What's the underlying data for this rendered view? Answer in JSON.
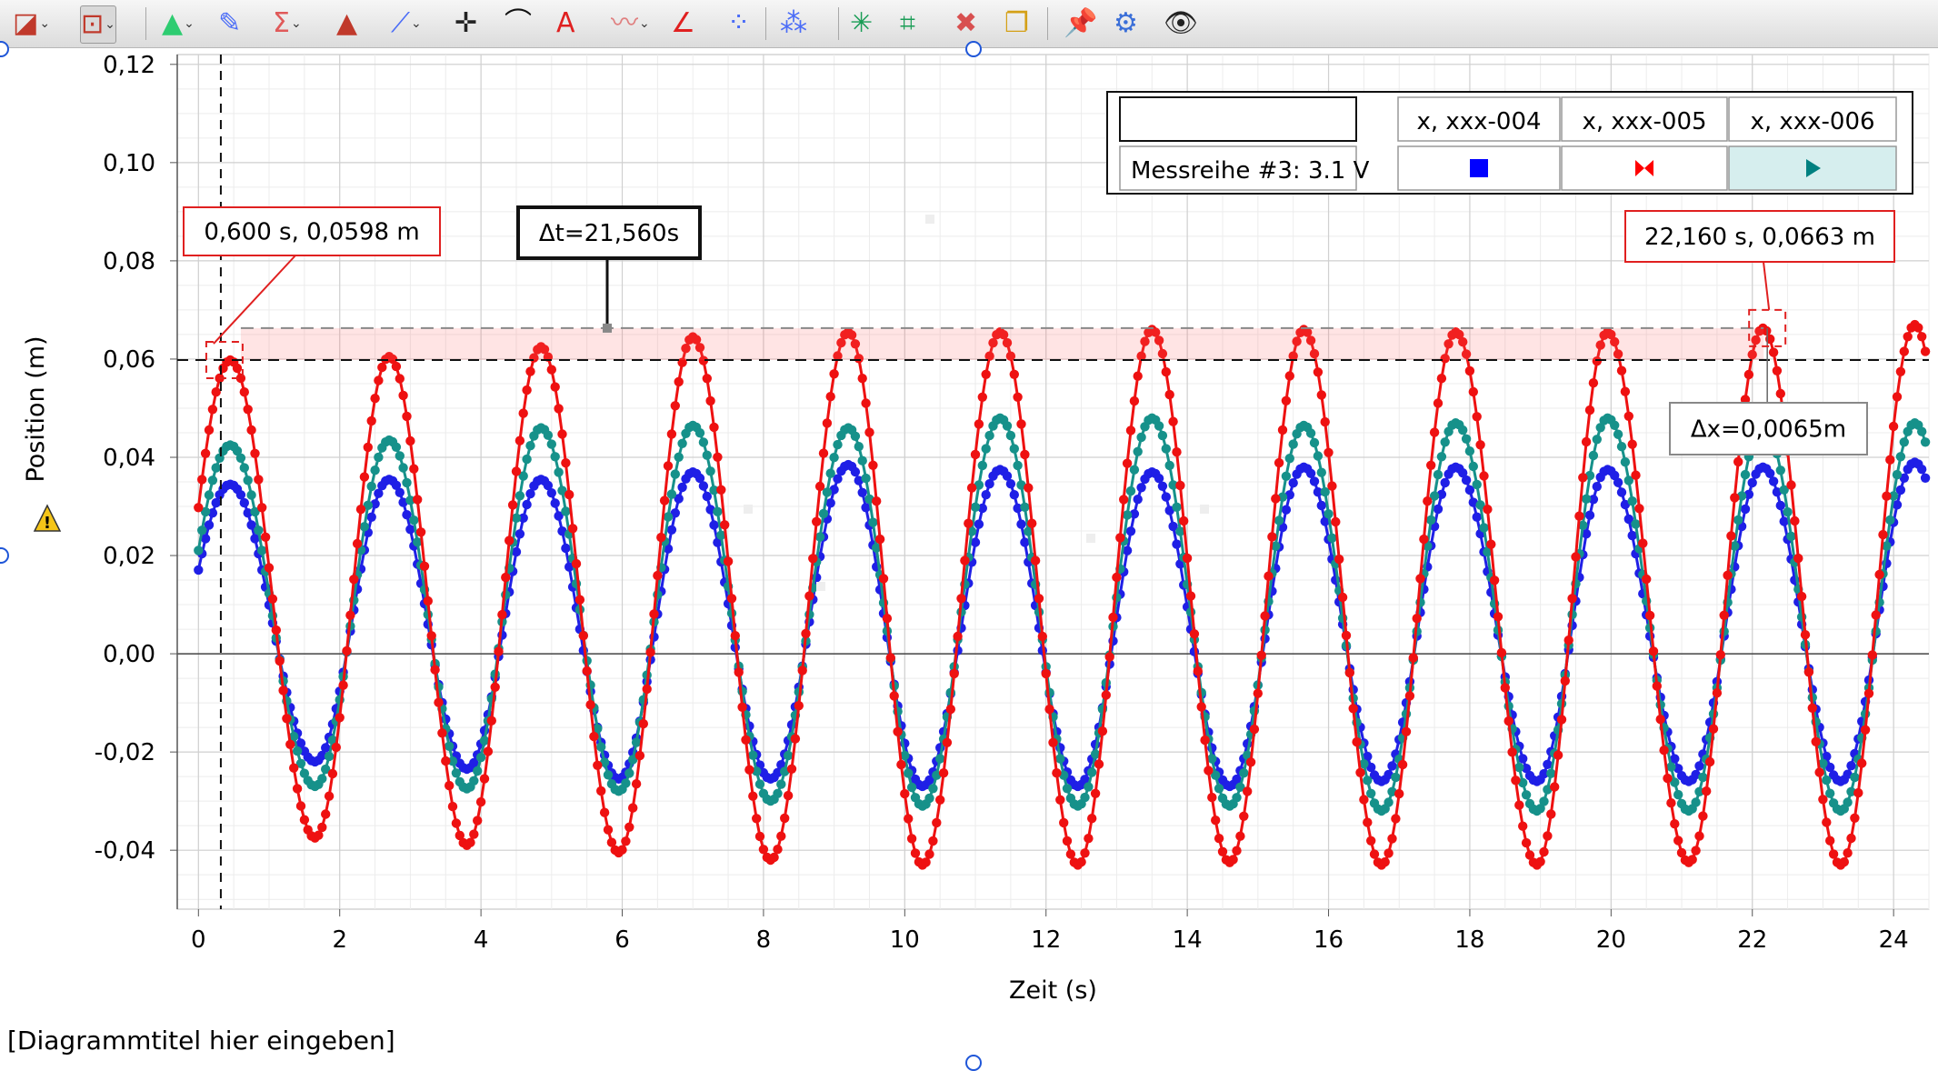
{
  "toolbar": {
    "items": [
      {
        "name": "graph-settings-icon",
        "glyph": "◪",
        "color": "#c0392b",
        "dropdown": true
      },
      {
        "name": "chart-layout-icon",
        "glyph": "⊡",
        "color": "#c0392b",
        "dropdown": true,
        "boxed": true
      },
      {
        "name": "color-palette-icon",
        "glyph": "▲",
        "color": "#2ecc71",
        "dropdown": true
      },
      {
        "name": "pen-icon",
        "glyph": "✎",
        "color": "#4a6cf7",
        "dropdown": false
      },
      {
        "name": "sum-icon",
        "glyph": "Σ",
        "color": "#e05a5a",
        "dropdown": true
      },
      {
        "name": "area-icon",
        "glyph": "▲",
        "color": "#c0392b",
        "dropdown": false
      },
      {
        "name": "fit-line-icon",
        "glyph": "⟋",
        "color": "#4a6cf7",
        "dropdown": true
      },
      {
        "name": "crosshair-icon",
        "glyph": "✛",
        "color": "#222222",
        "dropdown": false
      },
      {
        "name": "tangent-icon",
        "glyph": "⌒",
        "color": "#111111",
        "dropdown": false
      },
      {
        "name": "text-annotation-icon",
        "glyph": "A",
        "color": "#e02020",
        "dropdown": false
      },
      {
        "name": "noise-icon",
        "glyph": "〰",
        "color": "#e08080",
        "dropdown": true
      },
      {
        "name": "slope-icon",
        "glyph": "∠",
        "color": "#e02020",
        "dropdown": false
      },
      {
        "name": "scatter-icon",
        "glyph": "⁘",
        "color": "#4a6cf7",
        "dropdown": false
      },
      {
        "name": "connect-points-icon",
        "glyph": "⁂",
        "color": "#4a6cf7",
        "dropdown": false
      },
      {
        "name": "autoscale-icon",
        "glyph": "✳",
        "color": "#1a9d56",
        "dropdown": false
      },
      {
        "name": "zoom-box-icon",
        "glyph": "⌗",
        "color": "#1a9d56",
        "dropdown": false
      },
      {
        "name": "delete-icon",
        "glyph": "✖",
        "color": "#d85050",
        "dropdown": false
      },
      {
        "name": "copy-icon",
        "glyph": "❐",
        "color": "#d4a017",
        "dropdown": false
      },
      {
        "name": "pin-icon",
        "glyph": "📌",
        "color": "#e05a2a",
        "dropdown": false
      },
      {
        "name": "settings-gear-icon",
        "glyph": "⚙",
        "color": "#3b6fd8",
        "dropdown": false
      },
      {
        "name": "eye-icon",
        "glyph": "👁",
        "color": "#222222",
        "dropdown": false
      }
    ]
  },
  "chart_title": "[Diagrammtitel hier eingeben]",
  "chart_data": {
    "type": "scatter",
    "xlabel": "Zeit (s)",
    "ylabel": "Position (m)",
    "xlim": [
      -0.3,
      24.5
    ],
    "ylim": [
      -0.052,
      0.122
    ],
    "xticks": [
      0,
      2,
      4,
      6,
      8,
      10,
      12,
      14,
      16,
      18,
      20,
      22,
      24
    ],
    "yticks": [
      -0.04,
      -0.02,
      0.0,
      0.02,
      0.04,
      0.06,
      0.08,
      0.1,
      0.12
    ],
    "xtick_labels": [
      "0",
      "2",
      "4",
      "6",
      "8",
      "10",
      "12",
      "14",
      "16",
      "18",
      "20",
      "22",
      "24"
    ],
    "ytick_labels": [
      "-0,04",
      "-0,02",
      "0,00",
      "0,02",
      "0,04",
      "0,06",
      "0,08",
      "0,10",
      "0,12"
    ],
    "grid": true,
    "legend_position": "top-right",
    "legend": {
      "row_label": "Messreihe #3: 3.1 V",
      "columns": [
        {
          "name": "x, xxx-004",
          "marker": "square",
          "color": "#0000ff"
        },
        {
          "name": "x, xxx-005",
          "marker": "bowtie",
          "color": "#ff0000"
        },
        {
          "name": "x, xxx-006",
          "marker": "triangle",
          "color": "#008080"
        }
      ]
    },
    "series": [
      {
        "name": "x, xxx-004",
        "color": "#1f1fe6",
        "peaks": [
          [
            0.45,
            0.0345
          ],
          [
            2.7,
            0.0355
          ],
          [
            4.85,
            0.0355
          ],
          [
            7.0,
            0.037
          ],
          [
            9.2,
            0.0385
          ],
          [
            11.35,
            0.0375
          ],
          [
            13.5,
            0.037
          ],
          [
            15.65,
            0.038
          ],
          [
            17.8,
            0.038
          ],
          [
            19.95,
            0.0375
          ],
          [
            22.15,
            0.038
          ],
          [
            24.3,
            0.039
          ]
        ],
        "troughs": [
          [
            1.65,
            -0.022
          ],
          [
            3.8,
            -0.0235
          ],
          [
            5.95,
            -0.0255
          ],
          [
            8.1,
            -0.0255
          ],
          [
            10.25,
            -0.027
          ],
          [
            12.45,
            -0.027
          ],
          [
            14.6,
            -0.027
          ],
          [
            16.75,
            -0.026
          ],
          [
            18.95,
            -0.026
          ],
          [
            21.1,
            -0.026
          ],
          [
            23.25,
            -0.026
          ]
        ]
      },
      {
        "name": "x, xxx-005",
        "color": "#ee1111",
        "peaks": [
          [
            0.45,
            0.0598
          ],
          [
            2.7,
            0.0605
          ],
          [
            4.85,
            0.0625
          ],
          [
            7.0,
            0.0645
          ],
          [
            9.2,
            0.0655
          ],
          [
            11.35,
            0.0655
          ],
          [
            13.5,
            0.066
          ],
          [
            15.65,
            0.066
          ],
          [
            17.8,
            0.0655
          ],
          [
            19.95,
            0.0655
          ],
          [
            22.15,
            0.0663
          ],
          [
            24.3,
            0.067
          ]
        ],
        "troughs": [
          [
            1.65,
            -0.0375
          ],
          [
            3.8,
            -0.039
          ],
          [
            5.95,
            -0.0405
          ],
          [
            8.1,
            -0.042
          ],
          [
            10.25,
            -0.043
          ],
          [
            12.45,
            -0.043
          ],
          [
            14.6,
            -0.0425
          ],
          [
            16.75,
            -0.043
          ],
          [
            18.95,
            -0.043
          ],
          [
            21.1,
            -0.0425
          ],
          [
            23.25,
            -0.043
          ]
        ]
      },
      {
        "name": "x, xxx-006",
        "color": "#16918a",
        "peaks": [
          [
            0.45,
            0.0425
          ],
          [
            2.7,
            0.0435
          ],
          [
            4.85,
            0.046
          ],
          [
            7.0,
            0.0465
          ],
          [
            9.2,
            0.046
          ],
          [
            11.35,
            0.048
          ],
          [
            13.5,
            0.048
          ],
          [
            15.65,
            0.0465
          ],
          [
            17.8,
            0.047
          ],
          [
            19.95,
            0.048
          ],
          [
            22.15,
            0.047
          ],
          [
            24.3,
            0.047
          ]
        ],
        "troughs": [
          [
            1.65,
            -0.027
          ],
          [
            3.8,
            -0.0275
          ],
          [
            5.95,
            -0.028
          ],
          [
            8.1,
            -0.03
          ],
          [
            10.25,
            -0.031
          ],
          [
            12.45,
            -0.031
          ],
          [
            14.6,
            -0.031
          ],
          [
            16.75,
            -0.032
          ],
          [
            18.95,
            -0.032
          ],
          [
            21.1,
            -0.032
          ],
          [
            23.25,
            -0.032
          ]
        ]
      }
    ],
    "annotations": {
      "point1_label": "0,600 s, 0,0598 m",
      "point2_label": "22,160 s, 0,0663 m",
      "delta_t_label": "Δt=21,560s",
      "delta_x_label": "Δx=0,0065m",
      "point1": {
        "x": 0.6,
        "y": 0.0598
      },
      "point2": {
        "x": 22.16,
        "y": 0.0663
      }
    }
  }
}
